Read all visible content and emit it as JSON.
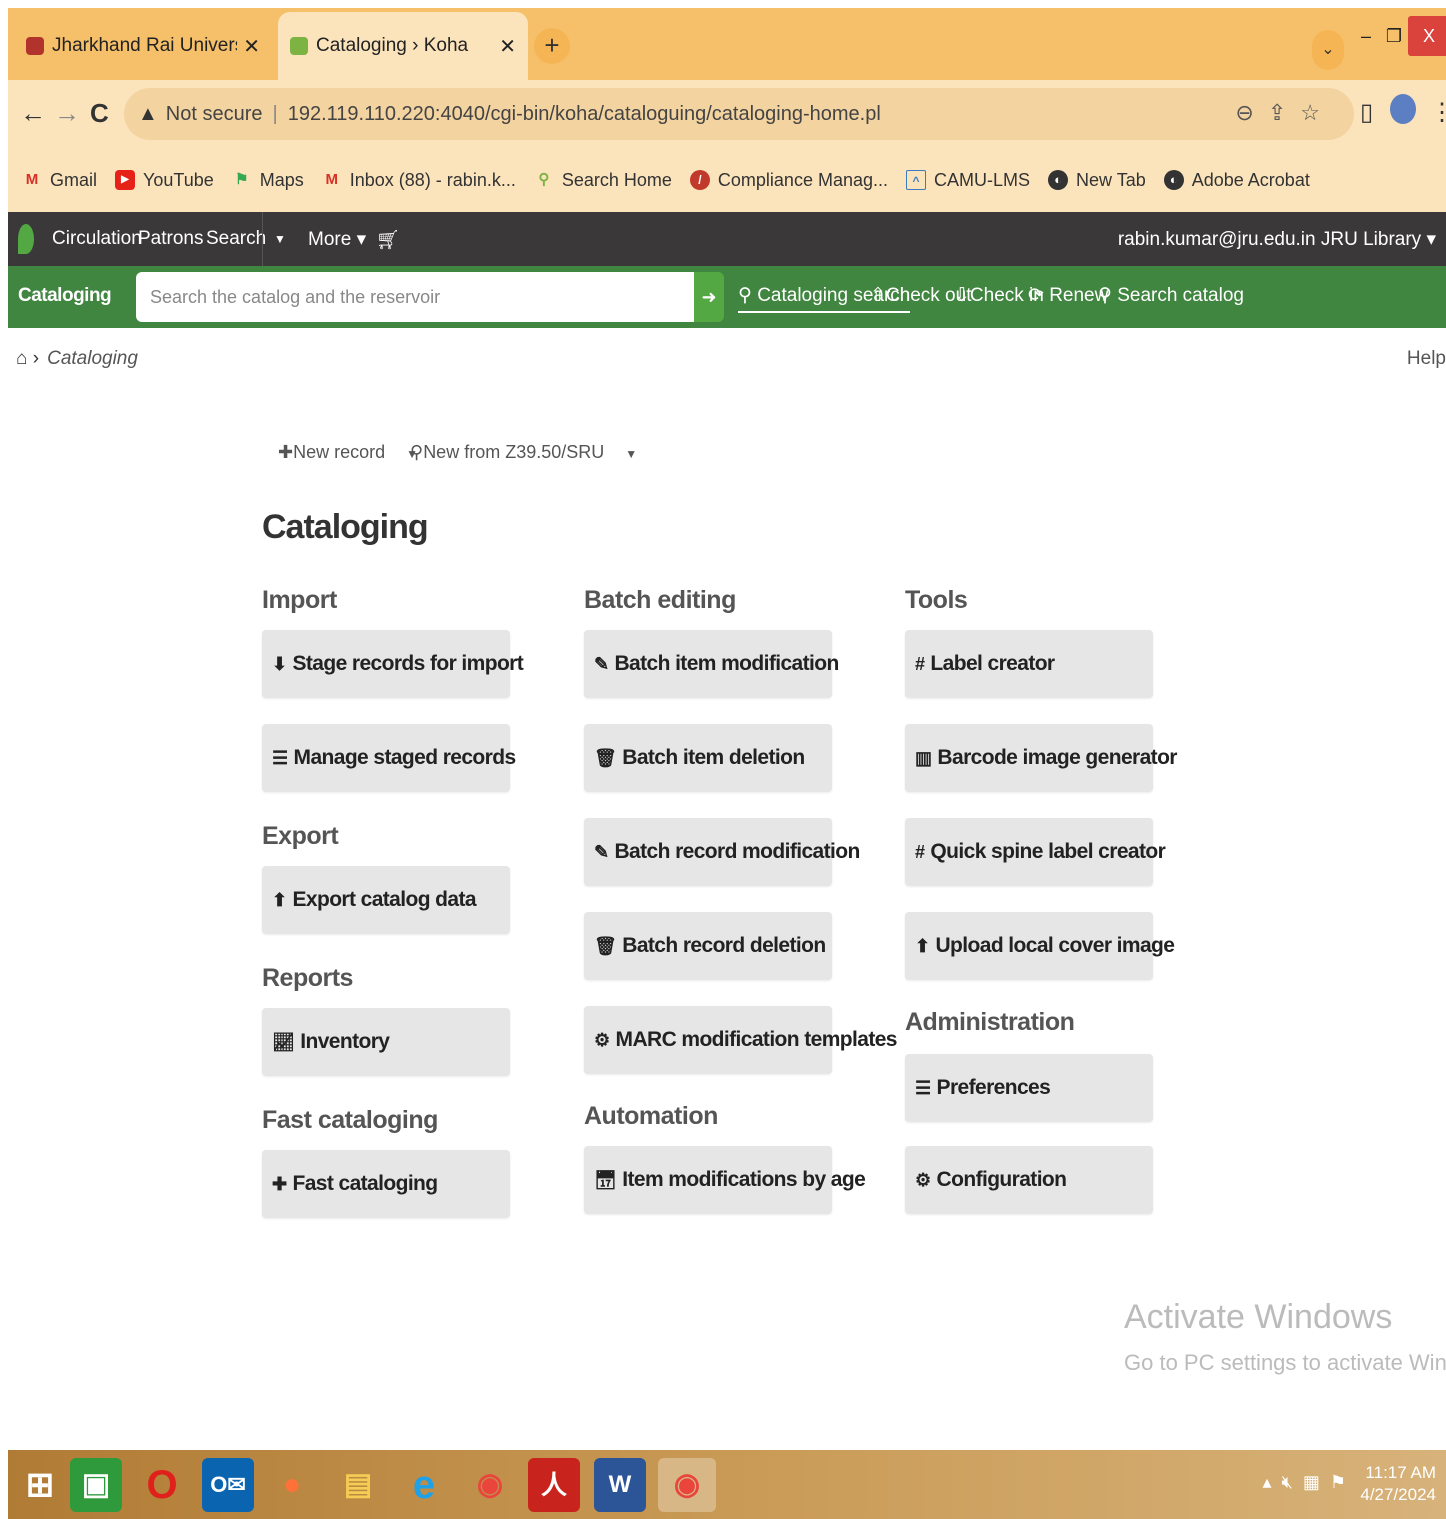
{
  "browser": {
    "tabs": [
      {
        "title": "Jharkhand Rai University (JRU), R",
        "active": false
      },
      {
        "title": "Cataloging › Koha",
        "active": true
      }
    ],
    "address": {
      "security": "Not secure",
      "url": "192.119.110.220:4040/cgi-bin/koha/cataloguing/cataloging-home.pl"
    },
    "bookmarks": [
      {
        "label": "Gmail",
        "icon": "gmail-icon"
      },
      {
        "label": "YouTube",
        "icon": "youtube-icon"
      },
      {
        "label": "Maps",
        "icon": "maps-icon"
      },
      {
        "label": "Inbox (88) - rabin.k...",
        "icon": "gmail-icon"
      },
      {
        "label": "Search Home",
        "icon": "search-home-icon"
      },
      {
        "label": "Compliance Manag...",
        "icon": "compliance-icon"
      },
      {
        "label": "CAMU-LMS",
        "icon": "camu-icon"
      },
      {
        "label": "New Tab",
        "icon": "globe-icon"
      },
      {
        "label": "Adobe Acrobat",
        "icon": "globe-icon"
      }
    ]
  },
  "koha": {
    "nav": {
      "circulation": "Circulation",
      "patrons": "Patrons",
      "search": "Search",
      "more": "More ▾",
      "user": "rabin.kumar@jru.edu.in JRU Library ▾"
    },
    "searchbar": {
      "label": "Cataloging search",
      "placeholder": "Search the catalog and the reservoir",
      "links": [
        "Cataloging search",
        "Check out",
        "Check in",
        "Renew",
        "Search catalog"
      ]
    },
    "breadcrumb": {
      "current": "Cataloging"
    },
    "help": "Help",
    "toolbar": {
      "new_record": "New record",
      "new_z3950": "New from Z39.50/SRU"
    },
    "page_title": "Cataloging",
    "sections": {
      "import": {
        "title": "Import",
        "buttons": [
          "Stage records for import",
          "Manage staged records"
        ]
      },
      "export": {
        "title": "Export",
        "buttons": [
          "Export catalog data"
        ]
      },
      "reports": {
        "title": "Reports",
        "buttons": [
          "Inventory"
        ]
      },
      "fast": {
        "title": "Fast cataloging",
        "buttons": [
          "Fast cataloging"
        ]
      },
      "batch": {
        "title": "Batch editing",
        "buttons": [
          "Batch item modification",
          "Batch item deletion",
          "Batch record modification",
          "Batch record deletion",
          "MARC modification templates"
        ]
      },
      "automation": {
        "title": "Automation",
        "buttons": [
          "Item modifications by age"
        ]
      },
      "tools": {
        "title": "Tools",
        "buttons": [
          "Label creator",
          "Barcode image generator",
          "Quick spine label creator",
          "Upload local cover image"
        ]
      },
      "admin": {
        "title": "Administration",
        "buttons": [
          "Preferences",
          "Configuration"
        ]
      }
    }
  },
  "watermark": {
    "line1": "Activate Windows",
    "line2": "Go to PC settings to activate Windows."
  },
  "taskbar": {
    "time": "11:17 AM",
    "date": "4/27/2024"
  },
  "colors": {
    "koha_green": "#408540",
    "koha_dark": "#3a3839",
    "tab_strip": "#f6c06a",
    "button_gray": "#e6e6e6"
  }
}
